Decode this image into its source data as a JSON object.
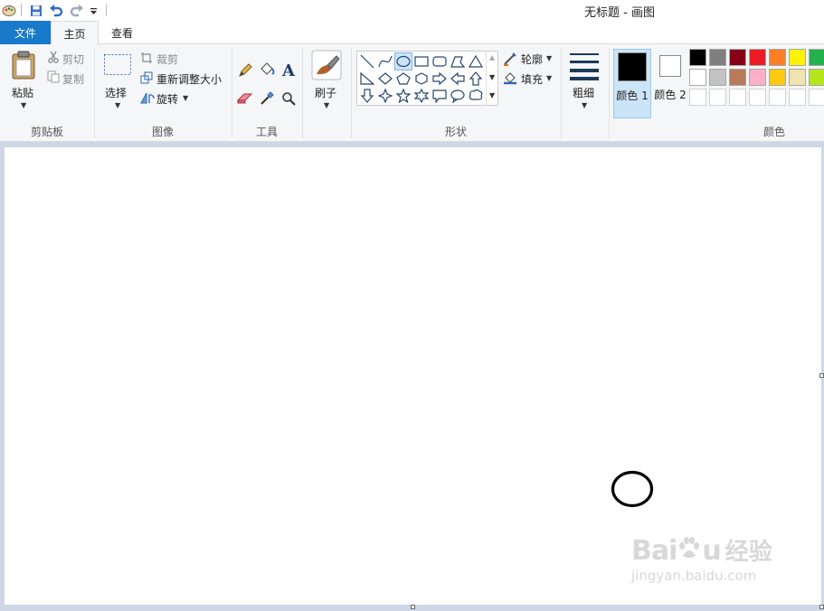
{
  "window": {
    "title": "无标题 - 画图"
  },
  "quick_access": {
    "app_icon": "paint-app-icon",
    "save_icon": "save-icon",
    "undo_icon": "undo-icon",
    "redo_icon": "redo-icon",
    "customize_icon": "customize-dropdown-icon"
  },
  "tabs": {
    "file": "文件",
    "home": "主页",
    "view": "查看"
  },
  "clipboard": {
    "paste": "粘贴",
    "cut": "剪切",
    "copy": "复制",
    "group": "剪贴板"
  },
  "image": {
    "select": "选择",
    "crop": "裁剪",
    "resize": "重新调整大小",
    "rotate": "旋转",
    "group": "图像"
  },
  "tools": {
    "group": "工具"
  },
  "brushes": {
    "label": "刷子"
  },
  "shapes": {
    "outline": "轮廓",
    "fill": "填充",
    "group": "形状"
  },
  "size": {
    "label": "粗细"
  },
  "colors": {
    "color1": "颜色 1",
    "color2": "颜色 2",
    "group": "颜色",
    "color1_value": "#000000",
    "color2_value": "#ffffff",
    "palette_row1": [
      "#000000",
      "#7f7f7f",
      "#880015",
      "#ed1c24",
      "#ff7f27",
      "#fff200",
      "#22b14c"
    ],
    "palette_row2": [
      "#ffffff",
      "#c3c3c3",
      "#b97a57",
      "#ffaec9",
      "#ffc90e",
      "#efe4b0",
      "#b5e61d"
    ],
    "palette_row3": [
      "#ffffff",
      "#ffffff",
      "#ffffff",
      "#ffffff",
      "#ffffff",
      "#ffffff",
      "#ffffff"
    ]
  },
  "watermark": {
    "brand_pre": "Bai",
    "brand_post": "u",
    "brand_cn": "经验",
    "url": "jingyan.baidu.com"
  }
}
